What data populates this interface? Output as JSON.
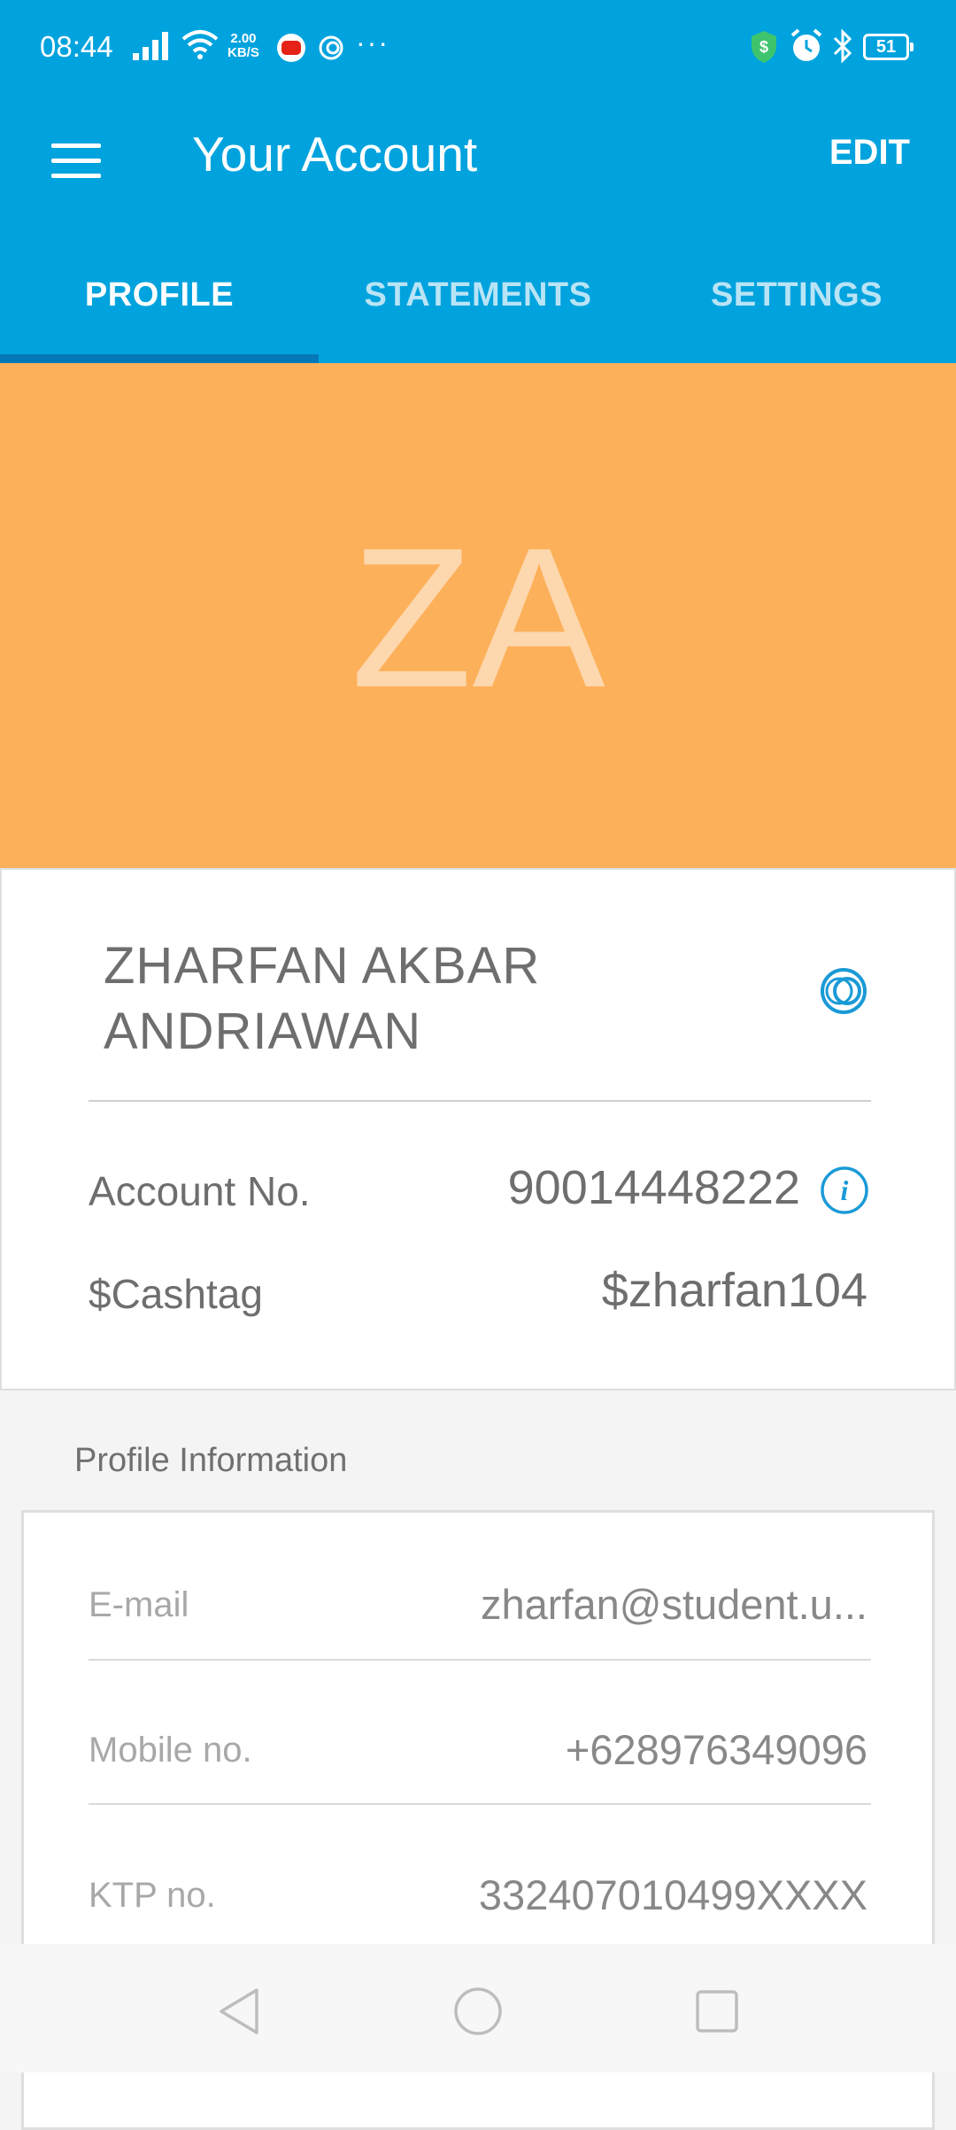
{
  "status_bar": {
    "time": "08:44",
    "speed_value": "2.00",
    "speed_unit": "KB/S",
    "battery": "51",
    "icons": [
      "signal-icon",
      "wifi-icon",
      "youtube-icon",
      "app-swirl-icon",
      "more-dots-icon",
      "shield-dollar-icon",
      "alarm-icon",
      "bluetooth-icon",
      "battery-icon"
    ]
  },
  "app_bar": {
    "title": "Your Account",
    "edit_label": "EDIT",
    "menu_icon": "menu-icon"
  },
  "tabs": [
    {
      "label": "PROFILE",
      "active": true
    },
    {
      "label": "STATEMENTS",
      "active": false
    },
    {
      "label": "SETTINGS",
      "active": false
    }
  ],
  "avatar": {
    "initials": "ZA",
    "background": "#fdb05a",
    "initials_color": "#fdd7ad"
  },
  "account_card": {
    "name_line1": "ZHARFAN AKBAR",
    "name_line2": "ANDRIAWAN",
    "account_no_label": "Account No.",
    "account_no_value": "90014448222",
    "cashtag_label": "$Cashtag",
    "cashtag_value": "$zharfan104"
  },
  "profile_info": {
    "section_title": "Profile Information",
    "fields": [
      {
        "label": "E-mail",
        "value": "zharfan@student.u..."
      },
      {
        "label": "Mobile no.",
        "value": "+628976349096"
      },
      {
        "label": "KTP no.",
        "value": "332407010499XXXX"
      }
    ]
  },
  "colors": {
    "primary": "#00a3de",
    "tab_indicator": "#0578b8",
    "accent_icon": "#1a9ad6"
  }
}
